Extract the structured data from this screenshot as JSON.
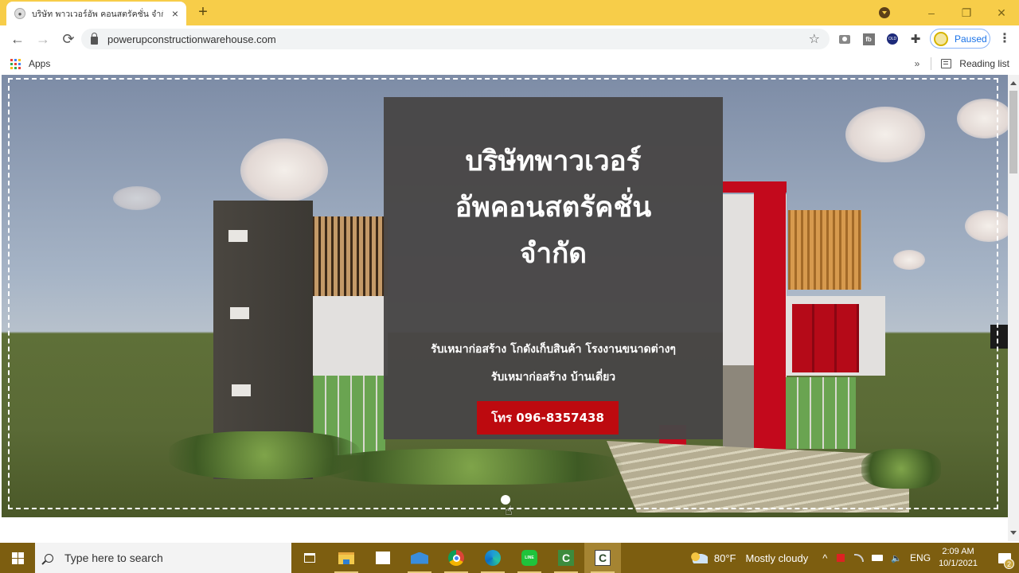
{
  "browser": {
    "tab": {
      "title": "บริษัท พาวเวอร์อัพ คอนสตรัคชั่น จำกัด",
      "close_glyph": "×"
    },
    "new_tab_glyph": "+",
    "window_controls": {
      "minimize": "–",
      "restore": "❐",
      "close": "✕"
    },
    "toolbar": {
      "back_glyph": "←",
      "forward_glyph": "→",
      "reload_glyph": "⟳",
      "url": "powerupconstructionwarehouse.com",
      "star_glyph": "☆",
      "extensions": [
        "camera-icon",
        "fb-icon",
        "database-icon",
        "puzzle-icon"
      ],
      "fb_label": "fb",
      "db_label": "OLD",
      "puzzle_glyph": "✚",
      "profile_label": "Paused",
      "menu_glyph": "⋮"
    },
    "bookmarks": {
      "apps_label": "Apps",
      "more_glyph": "»",
      "reading_list_label": "Reading list"
    }
  },
  "page": {
    "hero": {
      "title": "บริษัทพาวเวอร์ อัพคอนสตรัคชั่น จำกัด",
      "services_line1": "รับเหมาก่อสร้าง โกดังเก็บสินค้า โรงงานขนาดต่างๆ",
      "services_line2": "รับเหมาก่อสร้าง บ้านเดี่ยว",
      "call_button": "โทร 096-8357438",
      "slide_count": 1,
      "active_slide": 1
    },
    "colors": {
      "call_button_bg": "#bd0a0f",
      "overlay_bg": "#484646",
      "titlebar_bg": "#f7cd49",
      "taskbar_bg": "#7d5e10"
    }
  },
  "taskbar": {
    "search_placeholder": "Type here to search",
    "pinned": [
      "task-view-icon",
      "file-explorer-icon",
      "microsoft-store-icon",
      "mail-icon",
      "chrome-icon",
      "edge-icon",
      "line-icon",
      "camtasia-icon",
      "camtasia-recorder-icon"
    ],
    "weather": {
      "temp": "80°F",
      "condition": "Mostly cloudy"
    },
    "tray": {
      "chevron": "^",
      "language": "ENG",
      "volume_glyph": "🔈"
    },
    "clock": {
      "time": "2:09 AM",
      "date": "10/1/2021"
    },
    "notification_count": "2"
  }
}
